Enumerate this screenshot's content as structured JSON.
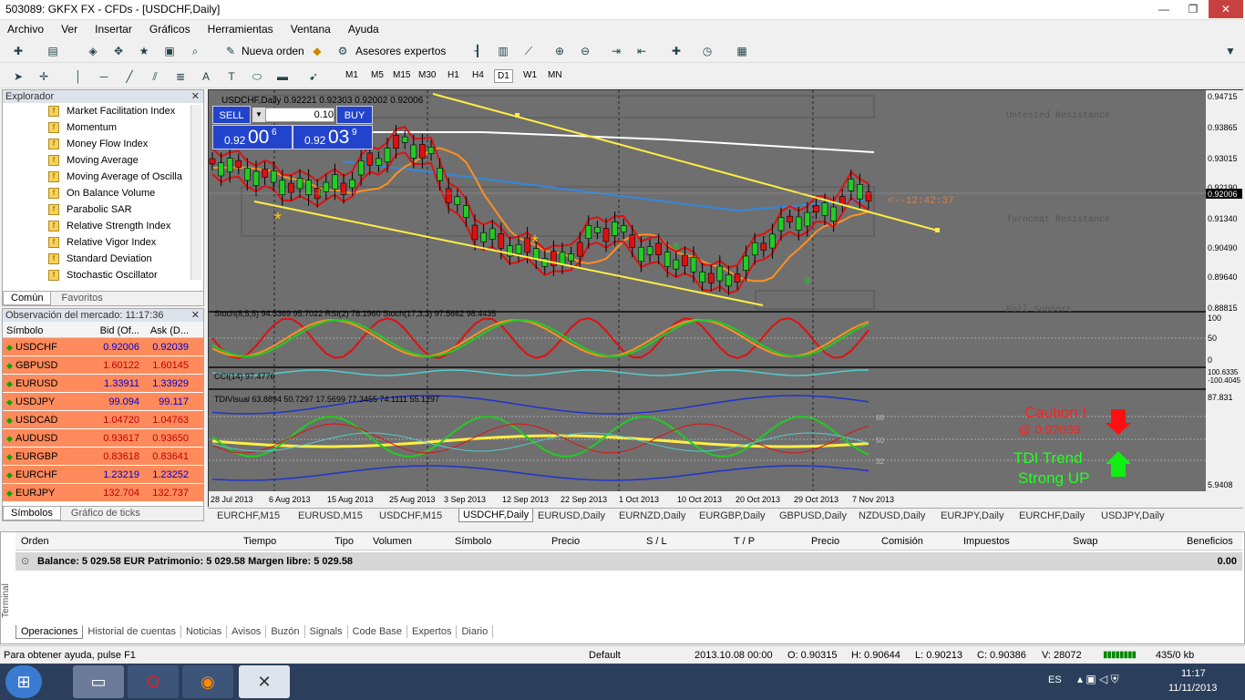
{
  "window": {
    "title": "503089: GKFX FX - CFDs - [USDCHF,Daily]",
    "min": "—",
    "max": "❐",
    "close": "✕"
  },
  "menu": [
    "Archivo",
    "Ver",
    "Insertar",
    "Gráficos",
    "Herramientas",
    "Ventana",
    "Ayuda"
  ],
  "toolbar": {
    "new_order": "Nueva orden",
    "experts": "Asesores expertos"
  },
  "timeframes": [
    "M1",
    "M5",
    "M15",
    "M30",
    "H1",
    "H4",
    "D1",
    "W1",
    "MN"
  ],
  "explorer": {
    "title": "Explorador",
    "items": [
      "Market Facilitation Index",
      "Momentum",
      "Money Flow Index",
      "Moving Average",
      "Moving Average of Oscilla",
      "On Balance Volume",
      "Parabolic SAR",
      "Relative Strength Index",
      "Relative Vigor Index",
      "Standard Deviation",
      "Stochastic Oscillator"
    ],
    "tabs": [
      "Común",
      "Favoritos"
    ]
  },
  "market": {
    "title": "Observación del mercado: 11:17:36",
    "headers": [
      "Símbolo",
      "Bid (Of...",
      "Ask (D..."
    ],
    "rows": [
      {
        "s": "USDCHF",
        "bid": "0.92006",
        "ask": "0.92039",
        "c": "blue",
        "up": true
      },
      {
        "s": "GBPUSD",
        "bid": "1.60122",
        "ask": "1.60145",
        "c": "red",
        "up": true
      },
      {
        "s": "EURUSD",
        "bid": "1.33911",
        "ask": "1.33929",
        "c": "blue",
        "up": true
      },
      {
        "s": "USDJPY",
        "bid": "99.094",
        "ask": "99.117",
        "c": "blue",
        "up": true
      },
      {
        "s": "USDCAD",
        "bid": "1.04720",
        "ask": "1.04763",
        "c": "red",
        "up": true
      },
      {
        "s": "AUDUSD",
        "bid": "0.93617",
        "ask": "0.93650",
        "c": "red",
        "up": true
      },
      {
        "s": "EURGBP",
        "bid": "0.83618",
        "ask": "0.83641",
        "c": "red",
        "up": true
      },
      {
        "s": "EURCHF",
        "bid": "1.23219",
        "ask": "1.23252",
        "c": "blue",
        "up": true
      },
      {
        "s": "EURJPY",
        "bid": "132.704",
        "ask": "132.737",
        "c": "red",
        "up": true
      }
    ],
    "tabs": [
      "Símbolos",
      "Gráfico de ticks"
    ]
  },
  "chart": {
    "header": "USDCHF,Daily  0.92221 0.92303 0.92002 0.92006",
    "sell": "SELL",
    "buy": "BUY",
    "lot": "0.10",
    "sell_big": "00",
    "sell_small": "0.92",
    "sell_sup": "6",
    "buy_big": "03",
    "buy_small": "0.92",
    "buy_sup": "9",
    "price_labels": [
      "0.94715",
      "0.93865",
      "0.93015",
      "0.92190",
      "0.92006",
      "0.91340",
      "0.90490",
      "0.89640",
      "0.88815"
    ],
    "current_price": "0.92006",
    "timer": "<--12:42:37",
    "res1": "Untested Resistance",
    "res2": "Turncoat Resistance",
    "res3": "Full Support",
    "stoch_label": "Stoch(8,5,5) 94.5369 95.7022  RSI(2) 78.1960  Stoch(17,3,3) 97.5662 98.4435",
    "stoch_ticks": [
      "100",
      "50",
      "0"
    ],
    "cci_label": "CCI(14) 97.4776",
    "cci_ticks": [
      "100.6335",
      "-100.4045"
    ],
    "tdi_label": "TDIVisual 63.8894 50.7297 17.5699 77.3455 74.1111 55.1297",
    "tdi_ticks": [
      "87.831",
      "5.9408"
    ],
    "tdi_levels": [
      "68",
      "50",
      "32"
    ],
    "caution": "Caution !",
    "caution_price": "@ 0.92039",
    "trend1": "TDI Trend",
    "trend2": "Strong UP",
    "dates": [
      "28 Jul 2013",
      "6 Aug 2013",
      "15 Aug 2013",
      "25 Aug 2013",
      "3 Sep 2013",
      "12 Sep 2013",
      "22 Sep 2013",
      "1 Oct 2013",
      "10 Oct 2013",
      "20 Oct 2013",
      "29 Oct 2013",
      "7 Nov 2013"
    ],
    "letters": [
      "B",
      "B",
      "B"
    ],
    "colors": {
      "bg": "#6f6f6f",
      "yellow": "#ffee44",
      "red": "#e01010",
      "orange": "#ff9020",
      "blue": "#3388dd",
      "white": "#ffffff",
      "green": "#22cc22",
      "cyan": "#55cccc"
    }
  },
  "chart_tabs": [
    "EURCHF,M15",
    "EURUSD,M15",
    "USDCHF,M15",
    "USDCHF,Daily",
    "EURUSD,Daily",
    "EURNZD,Daily",
    "EURGBP,Daily",
    "GBPUSD,Daily",
    "NZDUSD,Daily",
    "EURJPY,Daily",
    "EURCHF,Daily",
    "USDJPY,Daily"
  ],
  "terminal": {
    "headers": [
      "Orden",
      "Tiempo",
      "Tipo",
      "Volumen",
      "Símbolo",
      "Precio",
      "S / L",
      "T / P",
      "Precio",
      "Comisión",
      "Impuestos",
      "Swap",
      "Beneficios"
    ],
    "balance": "Balance: 5 029.58 EUR  Patrimonio: 5 029.58  Margen libre: 5 029.58",
    "profit": "0.00",
    "tabs": [
      "Operaciones",
      "Historial de cuentas",
      "Noticias",
      "Avisos",
      "Buzón",
      "Signals",
      "Code Base",
      "Expertos",
      "Diario"
    ],
    "side": "Terminal"
  },
  "status": {
    "help": "Para obtener ayuda, pulse F1",
    "profile": "Default",
    "time": "2013.10.08 00:00",
    "o": "O: 0.90315",
    "h": "H: 0.90644",
    "l": "L: 0.90213",
    "c": "C: 0.90386",
    "v": "V: 28072",
    "kb": "435/0 kb"
  },
  "taskbar": {
    "lang": "ES",
    "clock": "11:17",
    "date": "11/11/2013"
  }
}
